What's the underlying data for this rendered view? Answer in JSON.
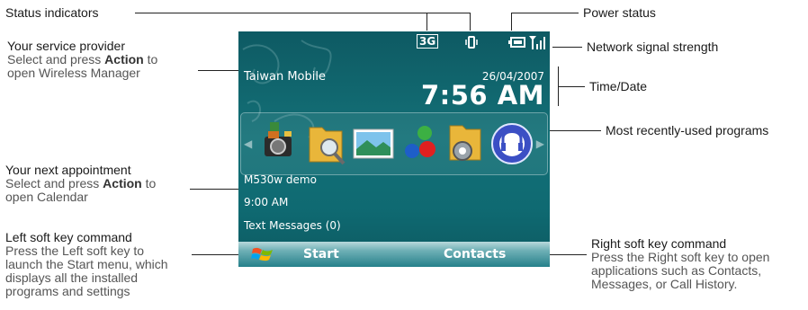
{
  "annotations": {
    "status_indicators": "Status indicators",
    "service_provider_title": "Your service provider",
    "service_provider_sub_1a": "Select and press ",
    "service_provider_sub_1b": "Action",
    "service_provider_sub_1c": " to",
    "service_provider_sub_2": "open Wireless Manager",
    "power_status": "Power status",
    "network_signal": "Network signal strength",
    "time_date": "Time/Date",
    "recent_programs": "Most recently-used programs",
    "next_appt_title": "Your next appointment",
    "next_appt_sub_1a": "Select and press ",
    "next_appt_sub_1b": "Action",
    "next_appt_sub_1c": " to",
    "next_appt_sub_2": "open Calendar",
    "left_soft_title": "Left soft key command",
    "left_soft_sub": [
      "Press the Left soft key to",
      "launch the Start menu, which",
      "displays all the installed",
      "programs and settings"
    ],
    "right_soft_title": "Right soft key command",
    "right_soft_sub": [
      "Press the Right soft key to open",
      "applications such as Contacts,",
      "Messages, or Call History."
    ]
  },
  "phone": {
    "status_3g": "3G",
    "carrier": "Taiwan Mobile",
    "date": "26/04/2007",
    "time": "7:56 AM",
    "appointment_title": "M530w demo",
    "appointment_time": "9:00 AM",
    "messages": "Text Messages (0)",
    "left_soft": "Start",
    "right_soft": "Contacts",
    "recent_apps": [
      "camera-app-icon",
      "file-explorer-icon",
      "pictures-icon",
      "messenger-icon",
      "settings-folder-icon",
      "media-player-icon"
    ]
  }
}
